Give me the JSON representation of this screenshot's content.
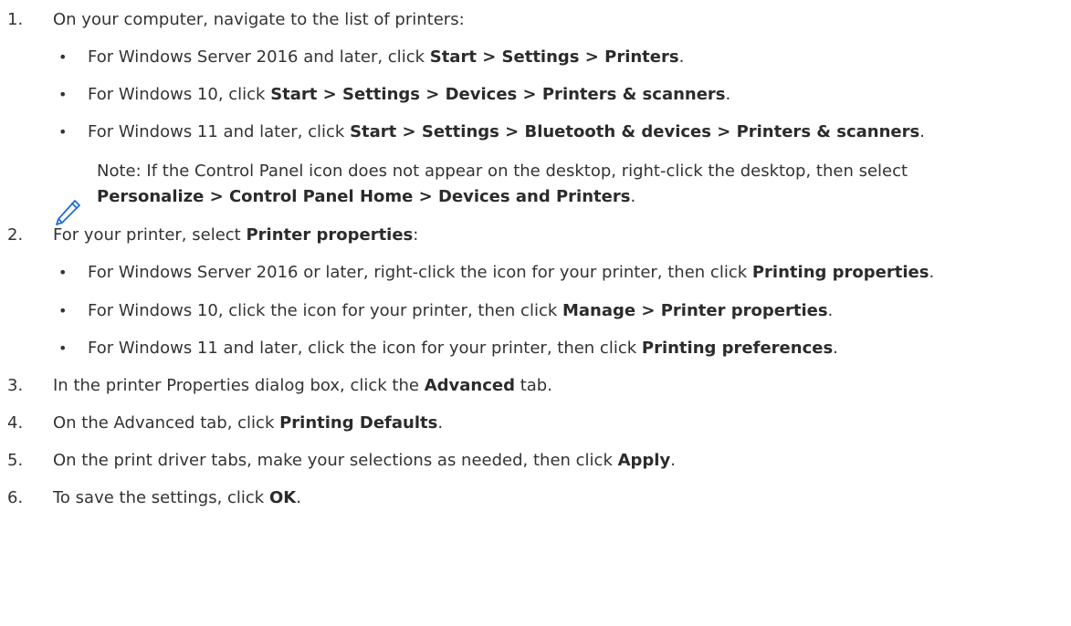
{
  "steps": [
    {
      "num": "1.",
      "text": "On your computer, navigate to the list of printers:",
      "bullets": [
        {
          "pre": "For Windows Server 2016 and later, click ",
          "bold": "Start > Settings > Printers",
          "post": "."
        },
        {
          "pre": "For Windows 10, click ",
          "bold": "Start > Settings > Devices > Printers & scanners",
          "post": "."
        },
        {
          "pre": "For Windows 11 and later, click ",
          "bold": "Start > Settings > Bluetooth & devices > Printers & scanners",
          "post": "."
        }
      ],
      "note": {
        "icon": "pencil-icon",
        "line1": "Note: If the Control Panel icon does not appear on the desktop, right-click the desktop, then select",
        "line2_bold": "Personalize > Control Panel Home > Devices and Printers",
        "line2_post": "."
      }
    },
    {
      "num": "2.",
      "pre": "For your printer, select ",
      "bold": "Printer properties",
      "post": ":",
      "bullets": [
        {
          "pre": "For Windows Server 2016 or later, right-click the icon for your printer, then click ",
          "bold": "Printing properties",
          "post": "."
        },
        {
          "pre": "For Windows 10, click the icon for your printer, then click ",
          "bold": "Manage > Printer properties",
          "post": "."
        },
        {
          "pre": "For Windows 11 and later, click the icon for your printer, then click ",
          "bold": "Printing preferences",
          "post": "."
        }
      ]
    },
    {
      "num": "3.",
      "pre": "In the printer Properties dialog box, click the ",
      "bold": "Advanced",
      "post": " tab."
    },
    {
      "num": "4.",
      "pre": "On the Advanced tab, click ",
      "bold": "Printing Defaults",
      "post": "."
    },
    {
      "num": "5.",
      "pre": "On the print driver tabs, make your selections as needed, then click ",
      "bold": "Apply",
      "post": "."
    },
    {
      "num": "6.",
      "pre": "To save the settings, click ",
      "bold": "OK",
      "post": "."
    }
  ],
  "colors": {
    "text": "#333333",
    "note_icon": "#1f6fd1"
  }
}
